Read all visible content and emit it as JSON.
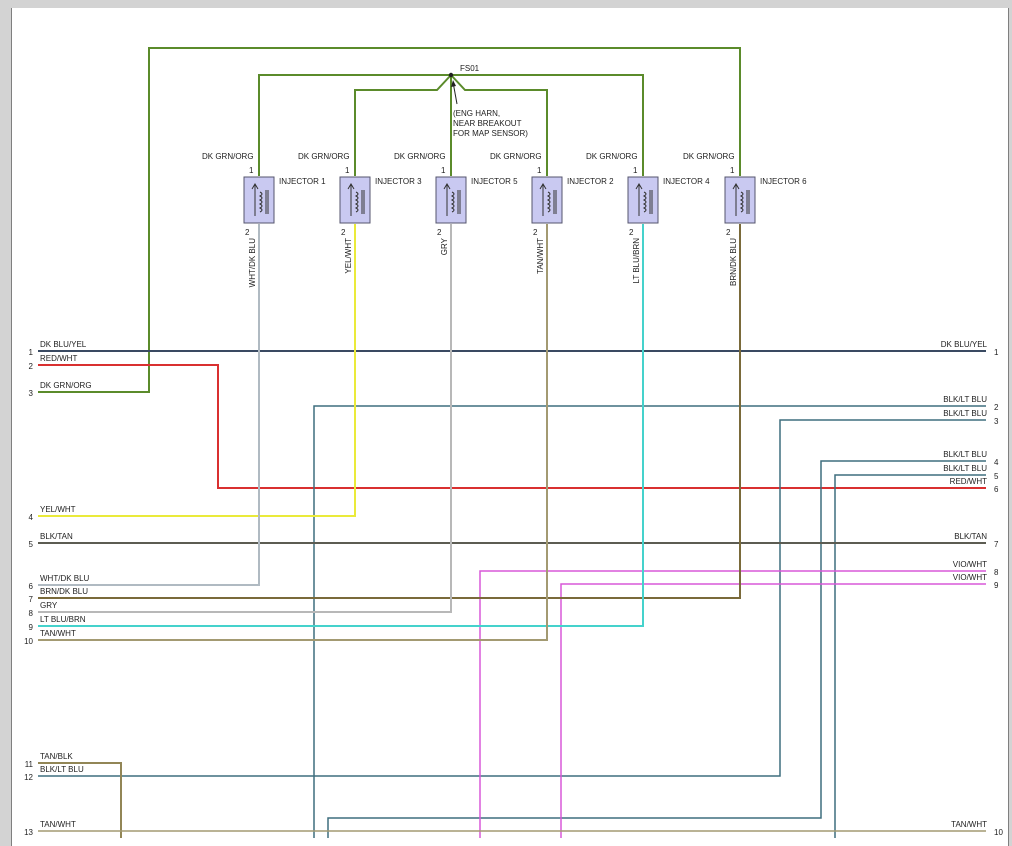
{
  "splice": {
    "id": "FS01",
    "note_lines": [
      "(ENG HARN,",
      "NEAR BREAKOUT",
      "FOR MAP SENSOR)"
    ]
  },
  "injectors": [
    {
      "name": "INJECTOR 1",
      "pin_top": "1",
      "pin_bottom": "2",
      "wire_top": "DK GRN/ORG",
      "wire_bottom": "WHT/DK BLU"
    },
    {
      "name": "INJECTOR 3",
      "pin_top": "1",
      "pin_bottom": "2",
      "wire_top": "DK GRN/ORG",
      "wire_bottom": "YEL/WHT"
    },
    {
      "name": "INJECTOR 5",
      "pin_top": "1",
      "pin_bottom": "2",
      "wire_top": "DK GRN/ORG",
      "wire_bottom": "GRY"
    },
    {
      "name": "INJECTOR 2",
      "pin_top": "1",
      "pin_bottom": "2",
      "wire_top": "DK GRN/ORG",
      "wire_bottom": "TAN/WHT"
    },
    {
      "name": "INJECTOR 4",
      "pin_top": "1",
      "pin_bottom": "2",
      "wire_top": "DK GRN/ORG",
      "wire_bottom": "LT BLU/BRN"
    },
    {
      "name": "INJECTOR 6",
      "pin_top": "1",
      "pin_bottom": "2",
      "wire_top": "DK GRN/ORG",
      "wire_bottom": "BRN/DK BLU"
    }
  ],
  "left_connector": [
    {
      "pin": "1",
      "wire": "DK BLU/YEL"
    },
    {
      "pin": "2",
      "wire": "RED/WHT"
    },
    {
      "pin": "3",
      "wire": "DK GRN/ORG"
    },
    {
      "pin": "4",
      "wire": "YEL/WHT"
    },
    {
      "pin": "5",
      "wire": "BLK/TAN"
    },
    {
      "pin": "6",
      "wire": "WHT/DK BLU"
    },
    {
      "pin": "7",
      "wire": "BRN/DK BLU"
    },
    {
      "pin": "8",
      "wire": "GRY"
    },
    {
      "pin": "9",
      "wire": "LT BLU/BRN"
    },
    {
      "pin": "10",
      "wire": "TAN/WHT"
    },
    {
      "pin": "11",
      "wire": "TAN/BLK"
    },
    {
      "pin": "12",
      "wire": "BLK/LT BLU"
    },
    {
      "pin": "13",
      "wire": "TAN/WHT"
    }
  ],
  "right_connector": [
    {
      "pin": "1",
      "wire": "DK BLU/YEL"
    },
    {
      "pin": "2",
      "wire": "BLK/LT BLU"
    },
    {
      "pin": "3",
      "wire": "BLK/LT BLU"
    },
    {
      "pin": "4",
      "wire": "BLK/LT BLU"
    },
    {
      "pin": "5",
      "wire": "BLK/LT BLU"
    },
    {
      "pin": "6",
      "wire": "RED/WHT"
    },
    {
      "pin": "7",
      "wire": "BLK/TAN"
    },
    {
      "pin": "8",
      "wire": "VIO/WHT"
    },
    {
      "pin": "9",
      "wire": "VIO/WHT"
    },
    {
      "pin": "10",
      "wire": "TAN/WHT"
    }
  ],
  "colors": {
    "dk_grn_org": "#5b8b2b",
    "dk_blu_yel": "#3a4a62",
    "red_wht": "#d93030",
    "yel_wht": "#eaea3a",
    "blk_tan": "#5c5c52",
    "wht_dk_blu": "#b0bac2",
    "brn_dk_blu": "#7a6a3a",
    "gry": "#b8b8b8",
    "lt_blu_brn": "#45d2cc",
    "tan_wht": "#a39a72",
    "tan_blk": "#928656",
    "blk_lt_blu": "#3f6e7e",
    "vio_wht": "#d858d8"
  }
}
